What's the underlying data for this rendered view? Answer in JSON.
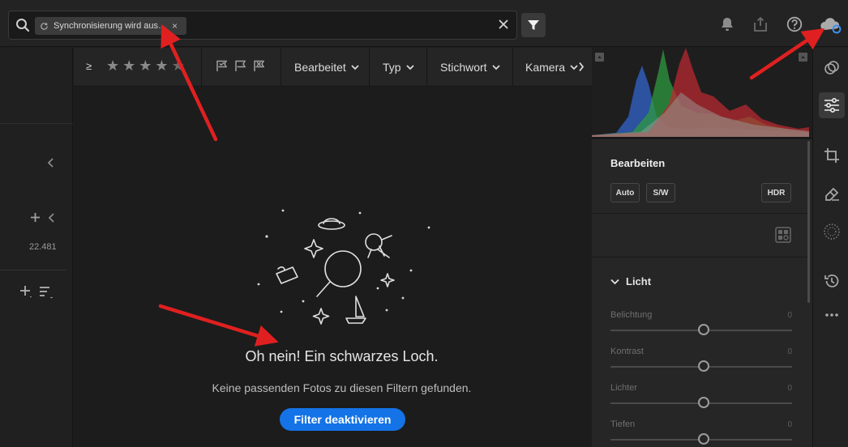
{
  "search": {
    "chip_label": "Synchronisierung wird aus…",
    "chip_remove": "×",
    "clear": "×"
  },
  "left_panel": {
    "photo_count": "22.481"
  },
  "filter_bar": {
    "rating_operator": "≥",
    "stars": [
      "★",
      "★",
      "★",
      "★",
      "★"
    ],
    "dropdowns": [
      "Bearbeitet",
      "Typ",
      "Stichwort",
      "Kamera"
    ]
  },
  "empty_state": {
    "headline": "Oh nein! Ein schwarzes Loch.",
    "message": "Keine passenden Fotos zu diesen Filtern gefunden.",
    "button": "Filter deaktivieren"
  },
  "edit_panel": {
    "title": "Bearbeiten",
    "auto": "Auto",
    "bw": "S/W",
    "hdr": "HDR",
    "section": "Licht",
    "sliders": [
      {
        "label": "Belichtung",
        "value": "0"
      },
      {
        "label": "Kontrast",
        "value": "0"
      },
      {
        "label": "Lichter",
        "value": "0"
      },
      {
        "label": "Tiefen",
        "value": "0"
      }
    ]
  },
  "tool_icons": [
    "presets-icon",
    "edit-sliders-icon",
    "crop-icon",
    "healing-icon",
    "masking-icon",
    "versions-icon",
    "more-icon"
  ],
  "colors": {
    "accent": "#1473e6",
    "annotation_arrow": "#e02020",
    "cloud_status": "#3b8ff0"
  }
}
